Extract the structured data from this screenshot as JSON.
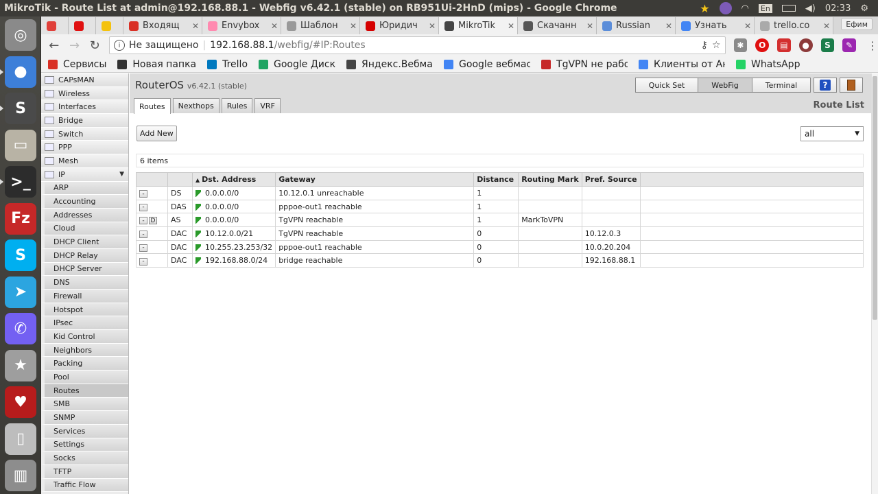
{
  "os": {
    "window_title": "MikroTik - Route List at admin@192.168.88.1 - Webfig v6.42.1 (stable) on RB951Ui-2HnD (mips) - Google Chrome",
    "lang": "En",
    "clock": "02:33"
  },
  "browser": {
    "tabs": [
      {
        "label": "",
        "color": "#e0403a"
      },
      {
        "label": "",
        "color": "#e01010"
      },
      {
        "label": "",
        "color": "#f4c20d"
      },
      {
        "label": "Входящ",
        "color": "#d93025"
      },
      {
        "label": "Envybox",
        "color": "#ff8ab0"
      },
      {
        "label": "Шаблон",
        "color": "#999999"
      },
      {
        "label": "Юридич",
        "color": "#d50000"
      },
      {
        "label": "MikroTik",
        "color": "#444444"
      },
      {
        "label": "Скачанн",
        "color": "#555555"
      },
      {
        "label": "Russian",
        "color": "#5b8dd9"
      },
      {
        "label": "Узнать",
        "color": "#4285f4"
      },
      {
        "label": "trello.co",
        "color": "#aaaaaa"
      }
    ],
    "profile": "Ефим",
    "security_label": "Не защищено",
    "url_host": "192.168.88.1",
    "url_path": "/webfig/#IP:Routes",
    "bookmarks": [
      {
        "label": "Сервисы",
        "color": "#d93025"
      },
      {
        "label": "Новая папка",
        "color": "#333333"
      },
      {
        "label": "Trello",
        "color": "#0079bf"
      },
      {
        "label": "Google Диск",
        "color": "#1fa463"
      },
      {
        "label": "Яндекс.Вебмас",
        "color": "#444444"
      },
      {
        "label": "Google вебмаст",
        "color": "#4285f4"
      },
      {
        "label": "TgVPN не работ",
        "color": "#c62828"
      },
      {
        "label": "Клиенты от Ан",
        "color": "#4285f4"
      },
      {
        "label": "WhatsApp",
        "color": "#25d366"
      }
    ]
  },
  "webfig": {
    "brand": "RouterOS",
    "version": "v6.42.1 (stable)",
    "modes": [
      "Quick Set",
      "WebFig",
      "Terminal"
    ],
    "active_mode": "WebFig",
    "menu_top": [
      "CAPsMAN",
      "Wireless",
      "Interfaces",
      "Bridge",
      "Switch",
      "PPP",
      "Mesh"
    ],
    "menu_ip": "IP",
    "menu_ip_sub": [
      "ARP",
      "Accounting",
      "Addresses",
      "Cloud",
      "DHCP Client",
      "DHCP Relay",
      "DHCP Server",
      "DNS",
      "Firewall",
      "Hotspot",
      "IPsec",
      "Kid Control",
      "Neighbors",
      "Packing",
      "Pool",
      "Routes",
      "SMB",
      "SNMP",
      "Services",
      "Settings",
      "Socks",
      "TFTP",
      "Traffic Flow"
    ],
    "selected_sub": "Routes",
    "tabs": [
      "Routes",
      "Nexthops",
      "Rules",
      "VRF"
    ],
    "page_title": "Route List",
    "add_new": "Add New",
    "filter_value": "all",
    "items_count": "6 items",
    "columns": [
      "Dst. Address",
      "Gateway",
      "Distance",
      "Routing Mark",
      "Pref. Source"
    ],
    "routes": [
      {
        "remove": "-",
        "disable": "",
        "flags": "DS",
        "dst": "0.0.0.0/0",
        "gateway": "10.12.0.1 unreachable",
        "distance": "1",
        "mark": "",
        "pref": ""
      },
      {
        "remove": "-",
        "disable": "",
        "flags": "DAS",
        "dst": "0.0.0.0/0",
        "gateway": "pppoe-out1 reachable",
        "distance": "1",
        "mark": "",
        "pref": ""
      },
      {
        "remove": "-",
        "disable": "D",
        "flags": "AS",
        "dst": "0.0.0.0/0",
        "gateway": "TgVPN reachable",
        "distance": "1",
        "mark": "MarkToVPN",
        "pref": ""
      },
      {
        "remove": "-",
        "disable": "",
        "flags": "DAC",
        "dst": "10.12.0.0/21",
        "gateway": "TgVPN reachable",
        "distance": "0",
        "mark": "",
        "pref": "10.12.0.3"
      },
      {
        "remove": "-",
        "disable": "",
        "flags": "DAC",
        "dst": "10.255.23.253/32",
        "gateway": "pppoe-out1 reachable",
        "distance": "0",
        "mark": "",
        "pref": "10.0.20.204"
      },
      {
        "remove": "-",
        "disable": "",
        "flags": "DAC",
        "dst": "192.168.88.0/24",
        "gateway": "bridge reachable",
        "distance": "0",
        "mark": "",
        "pref": "192.168.88.1"
      }
    ]
  },
  "launcher": [
    {
      "name": "ubuntu-dash-icon",
      "color": "#8a8a8a",
      "glyph": "◎"
    },
    {
      "name": "chrome-icon",
      "color": "#3d7fd9",
      "glyph": "●"
    },
    {
      "name": "sublime-icon",
      "color": "#4a4a4a",
      "glyph": "S"
    },
    {
      "name": "files-icon",
      "color": "#b8b3a5",
      "glyph": "▭"
    },
    {
      "name": "terminal-icon",
      "color": "#2c2c2c",
      "glyph": ">_"
    },
    {
      "name": "filezilla-icon",
      "color": "#c62828",
      "glyph": "Fz"
    },
    {
      "name": "skype-icon",
      "color": "#00aff0",
      "glyph": "S"
    },
    {
      "name": "telegram-icon",
      "color": "#2ca5e0",
      "glyph": "➤"
    },
    {
      "name": "viber-icon",
      "color": "#7360f2",
      "glyph": "✆"
    },
    {
      "name": "app-icon",
      "color": "#9e9e9e",
      "glyph": "★"
    },
    {
      "name": "wine-icon",
      "color": "#b71c1c",
      "glyph": "♥"
    },
    {
      "name": "usb-icon",
      "color": "#bdbdbd",
      "glyph": "▯"
    },
    {
      "name": "trash-icon",
      "color": "#8d8d8d",
      "glyph": "▥"
    }
  ]
}
